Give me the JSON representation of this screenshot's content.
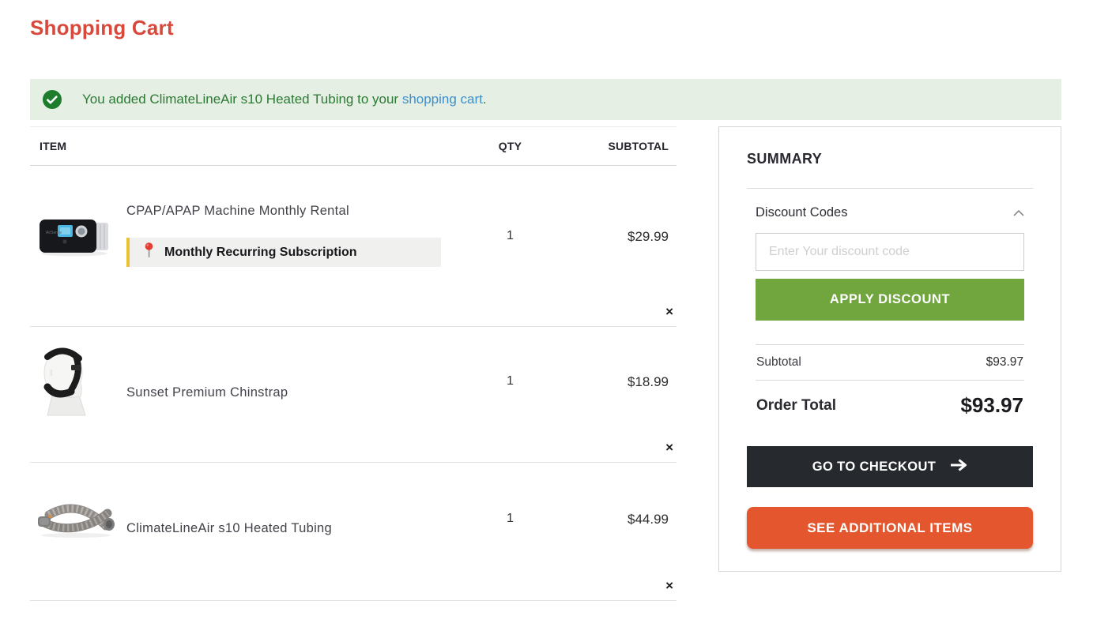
{
  "page": {
    "title": "Shopping Cart"
  },
  "banner": {
    "message_prefix": "You added ClimateLineAir s10 Heated Tubing to your ",
    "link_text": "shopping cart",
    "message_suffix": "."
  },
  "cart": {
    "columns": {
      "item": "ITEM",
      "qty": "QTY",
      "subtotal": "SUBTOTAL"
    },
    "remove_label": "×",
    "items": [
      {
        "title": "CPAP/APAP Machine Monthly Rental",
        "badge": "Monthly Recurring Subscription",
        "qty": "1",
        "subtotal": "$29.99"
      },
      {
        "title": "Sunset Premium Chinstrap",
        "qty": "1",
        "subtotal": "$18.99"
      },
      {
        "title": "ClimateLineAir s10 Heated Tubing",
        "qty": "1",
        "subtotal": "$44.99"
      }
    ]
  },
  "summary": {
    "title": "SUMMARY",
    "discount": {
      "label": "Discount Codes",
      "input_placeholder": "Enter Your discount code",
      "apply_label": "APPLY DISCOUNT"
    },
    "subtotal_label": "Subtotal",
    "subtotal_value": "$93.97",
    "order_total_label": "Order Total",
    "order_total_value": "$93.97",
    "checkout_label": "GO TO CHECKOUT",
    "additional_items_label": "SEE ADDITIONAL ITEMS"
  },
  "colors": {
    "heading_red": "#d8493c",
    "success_bg": "#e5efe3",
    "success_text": "#2b7a34",
    "success_icon": "#1e7d2c",
    "link_blue": "#3f8fc9",
    "badge_yellow": "#eac233",
    "apply_green": "#71a53d",
    "checkout_dark": "#26292e",
    "additional_orange": "#e4572e"
  }
}
